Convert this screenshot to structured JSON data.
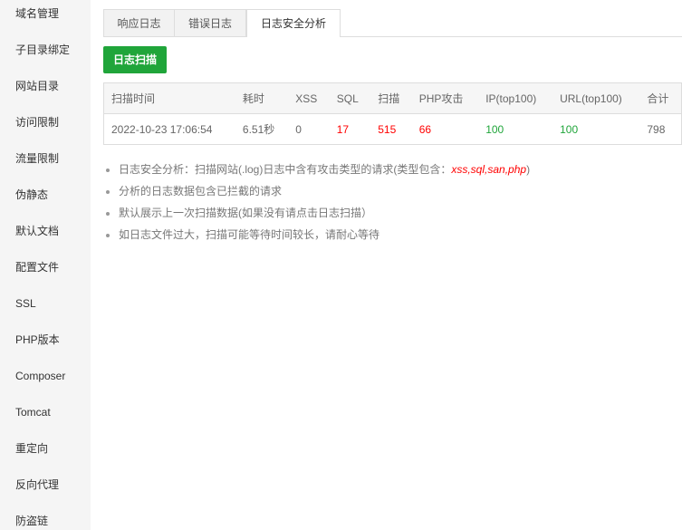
{
  "sidebar": {
    "items": [
      {
        "label": "域名管理",
        "name": "sidebar-item-domain"
      },
      {
        "label": "子目录绑定",
        "name": "sidebar-item-subdir-bind"
      },
      {
        "label": "网站目录",
        "name": "sidebar-item-site-dir"
      },
      {
        "label": "访问限制",
        "name": "sidebar-item-access-limit"
      },
      {
        "label": "流量限制",
        "name": "sidebar-item-traffic-limit"
      },
      {
        "label": "伪静态",
        "name": "sidebar-item-rewrite"
      },
      {
        "label": "默认文档",
        "name": "sidebar-item-default-doc"
      },
      {
        "label": "配置文件",
        "name": "sidebar-item-config-file"
      },
      {
        "label": "SSL",
        "name": "sidebar-item-ssl"
      },
      {
        "label": "PHP版本",
        "name": "sidebar-item-php-version"
      },
      {
        "label": "Composer",
        "name": "sidebar-item-composer"
      },
      {
        "label": "Tomcat",
        "name": "sidebar-item-tomcat"
      },
      {
        "label": "重定向",
        "name": "sidebar-item-redirect"
      },
      {
        "label": "反向代理",
        "name": "sidebar-item-reverse-proxy"
      },
      {
        "label": "防盗链",
        "name": "sidebar-item-hotlink"
      }
    ]
  },
  "tabs": [
    {
      "label": "响应日志",
      "active": false
    },
    {
      "label": "错误日志",
      "active": false
    },
    {
      "label": "日志安全分析",
      "active": true
    }
  ],
  "scan_button": {
    "label": "日志扫描"
  },
  "table": {
    "headers": [
      "扫描时间",
      "耗时",
      "XSS",
      "SQL",
      "扫描",
      "PHP攻击",
      "IP(top100)",
      "URL(top100)",
      "合计"
    ],
    "row": {
      "time": "2022-10-23 17:06:54",
      "duration": "6.51秒",
      "xss": "0",
      "sql": "17",
      "scan": "515",
      "php": "66",
      "ip_top100": "100",
      "url_top100": "100",
      "total": "798"
    }
  },
  "notes": {
    "note1_prefix": "日志安全分析：扫描网站(.log)日志中含有攻击类型的请求(类型包含：",
    "note1_types": "xss,sql,san,php",
    "note1_suffix": ")",
    "note2": "分析的日志数据包含已拦截的请求",
    "note3": "默认展示上一次扫描数据(如果没有请点击日志扫描）",
    "note4": "如日志文件过大，扫描可能等待时间较长，请耐心等待"
  },
  "colors": {
    "accent_green": "#20a53a",
    "alert_red": "#ff0000",
    "sidebar_bg": "#f5f5f5"
  }
}
